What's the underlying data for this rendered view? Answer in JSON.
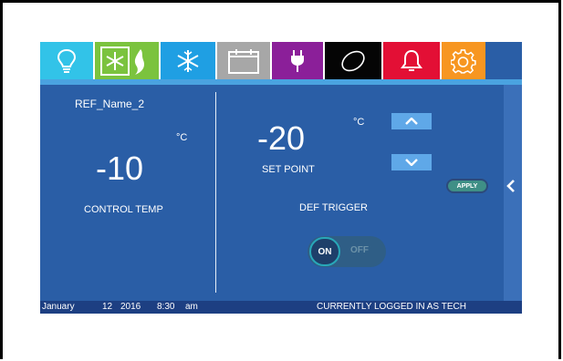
{
  "tabs": [
    {
      "icon": "lightbulb-icon",
      "color": "#32c3e8"
    },
    {
      "icon": "defrost-icon",
      "color": "#7bc33e"
    },
    {
      "icon": "snowflake-icon",
      "color": "#1f9fe3"
    },
    {
      "icon": "calendar-icon",
      "color": "#a7a7a7"
    },
    {
      "icon": "plug-icon",
      "color": "#8b1f99"
    },
    {
      "icon": "sensor-icon",
      "color": "#050505"
    },
    {
      "icon": "bell-icon",
      "color": "#e30f35"
    },
    {
      "icon": "gear-icon",
      "color": "#f79621"
    }
  ],
  "left_panel": {
    "name": "REF_Name_2",
    "unit": "°C",
    "value": "-10",
    "label": "CONTROL TEMP"
  },
  "right_panel": {
    "unit": "°C",
    "value": "-20",
    "label": "SET POINT",
    "apply_label": "APPLY",
    "trigger_label": "DEF TRIGGER",
    "toggle_on": "ON",
    "toggle_off": "OFF"
  },
  "status_bar": {
    "month": "January",
    "day": "12",
    "year": "2016",
    "time": "8:30",
    "ampm": "am",
    "user": "CURRENTLY LOGGED IN AS TECH"
  }
}
